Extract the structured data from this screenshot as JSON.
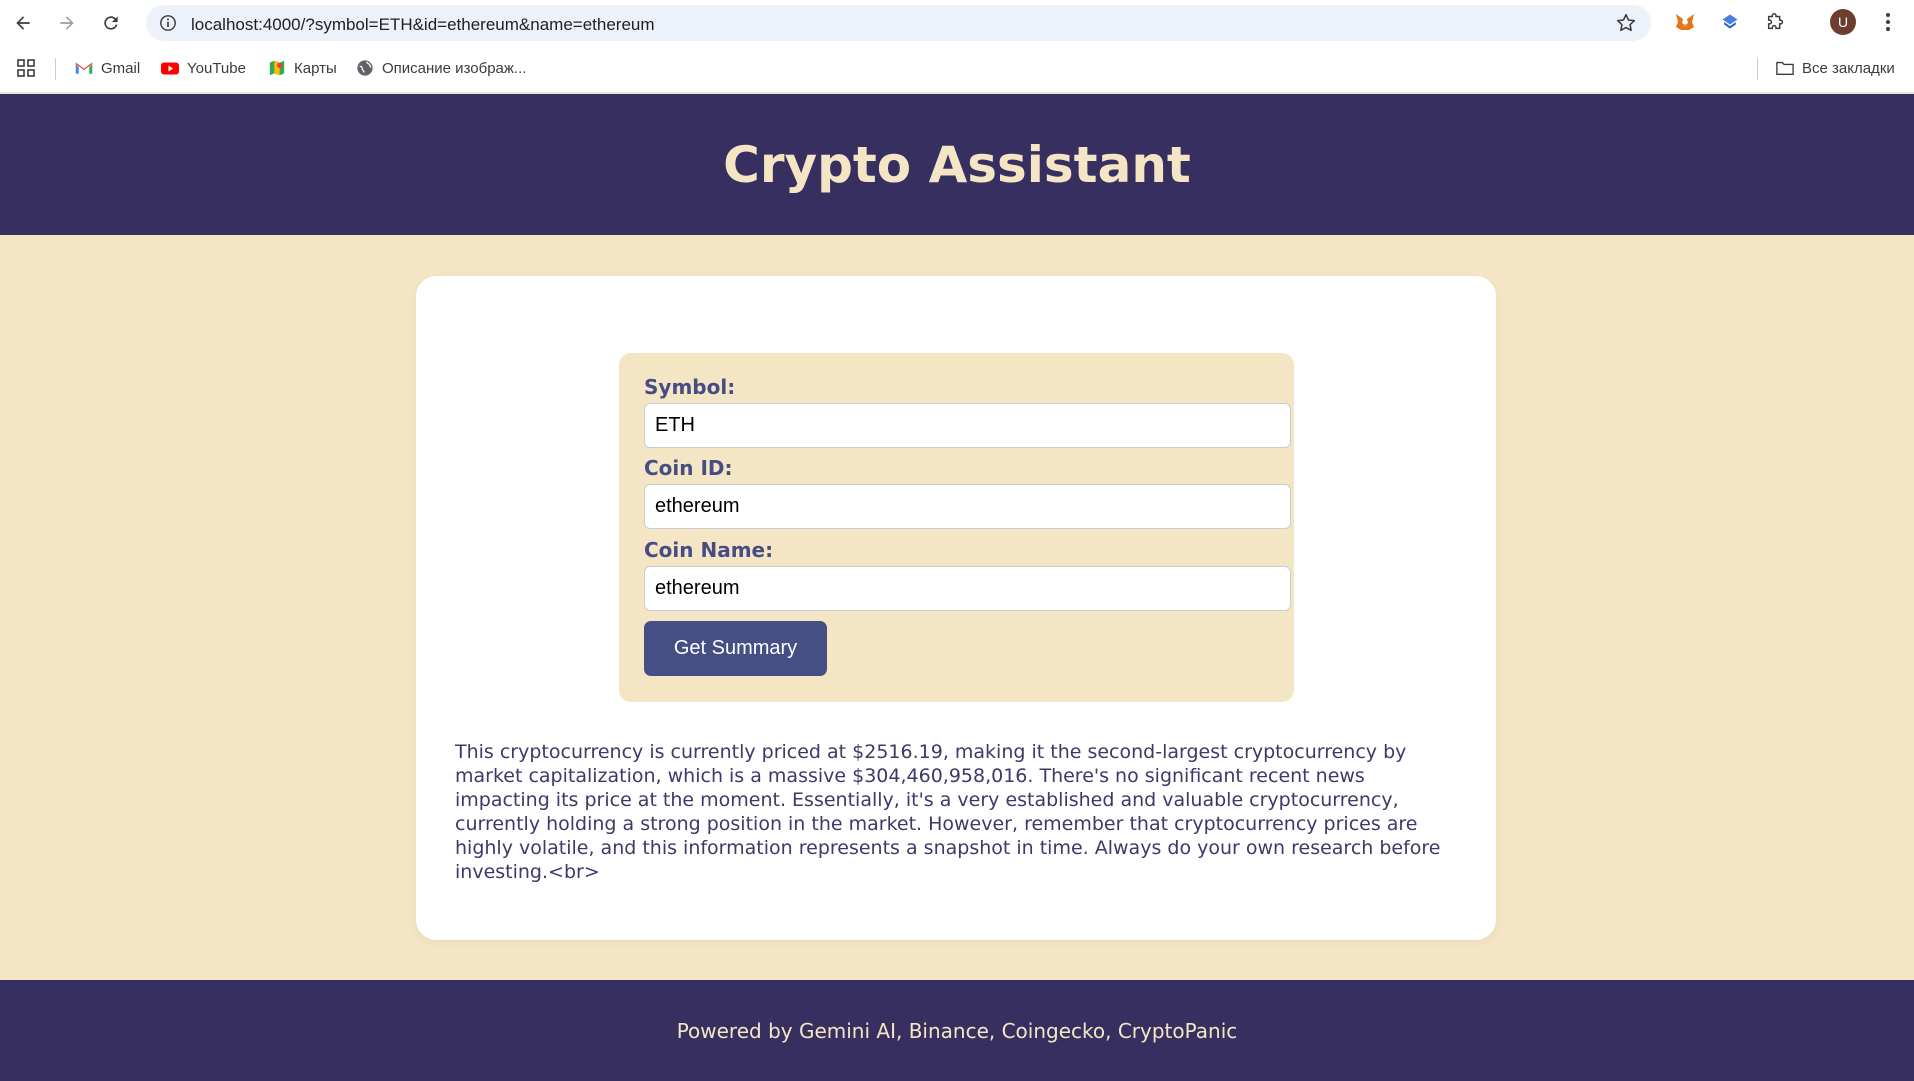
{
  "browser": {
    "url": "localhost:4000/?symbol=ETH&id=ethereum&name=ethereum",
    "avatar_letter": "U",
    "bookmarks": [
      {
        "label": "Gmail",
        "icon": "gmail-icon"
      },
      {
        "label": "YouTube",
        "icon": "youtube-icon"
      },
      {
        "label": "Карты",
        "icon": "maps-icon"
      },
      {
        "label": "Описание изображ...",
        "icon": "globe-icon"
      }
    ],
    "all_bookmarks_label": "Все закладки"
  },
  "header": {
    "title": "Crypto Assistant"
  },
  "form": {
    "symbol_label": "Symbol:",
    "symbol_value": "ETH",
    "coin_id_label": "Coin ID:",
    "coin_id_value": "ethereum",
    "coin_name_label": "Coin Name:",
    "coin_name_value": "ethereum",
    "submit_label": "Get Summary"
  },
  "summary": {
    "text": "This cryptocurrency is currently priced at $2516.19, making it the second-largest cryptocurrency by market capitalization, which is a massive $304,460,958,016. There's no significant recent news impacting its price at the moment. Essentially, it's a very established and valuable cryptocurrency, currently holding a strong position in the market. However, remember that cryptocurrency prices are highly volatile, and this information represents a snapshot in time. Always do your own research before investing.<br>"
  },
  "footer": {
    "text": "Powered by Gemini AI, Binance, Coingecko, CryptoPanic"
  },
  "colors": {
    "header_bg": "#362f60",
    "page_bg": "#f4e6c5",
    "button_bg": "#454f83",
    "label_color": "#474d84"
  }
}
